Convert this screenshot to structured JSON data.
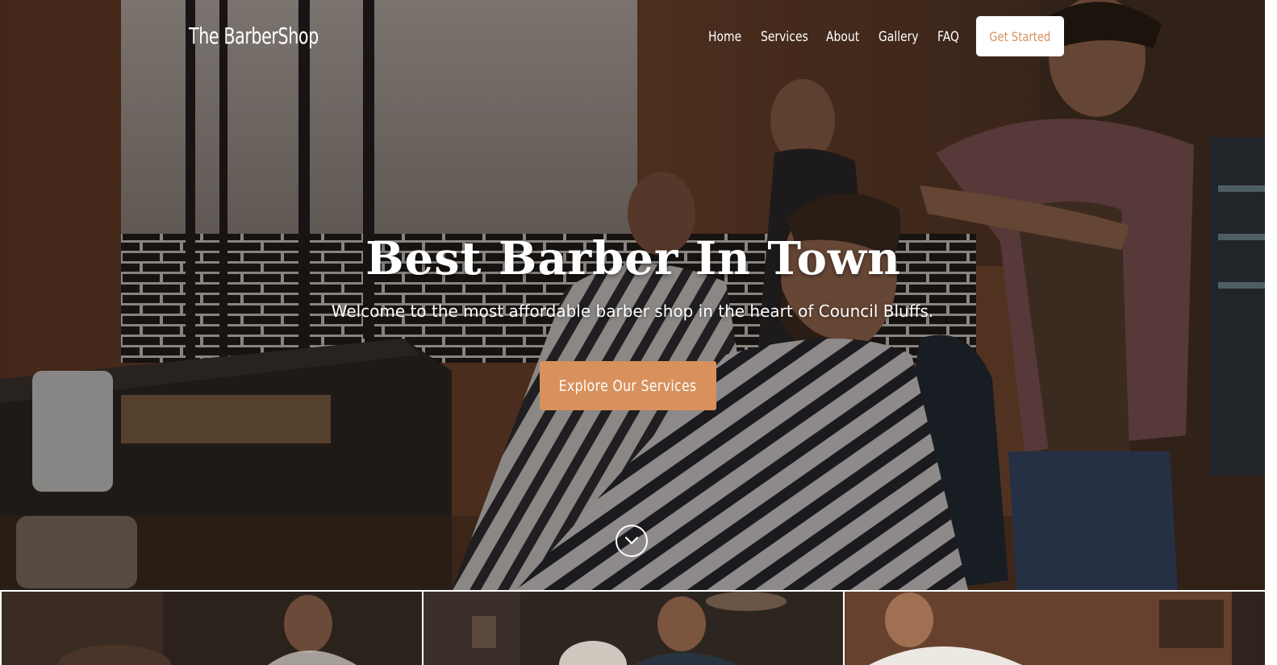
{
  "brand": "The BarberShop",
  "nav": {
    "items": [
      "Home",
      "Services",
      "About",
      "Gallery",
      "FAQ"
    ],
    "cta": "Get Started"
  },
  "hero": {
    "headline": "Best Barber In Town",
    "subline": "Welcome to the most affordable barber shop in the heart of Council Bluffs.",
    "button": "Explore Our Services",
    "scroll_icon": "chevron-down-circle-icon"
  },
  "colors": {
    "accent": "#d8915d",
    "text": "#ffffff"
  }
}
